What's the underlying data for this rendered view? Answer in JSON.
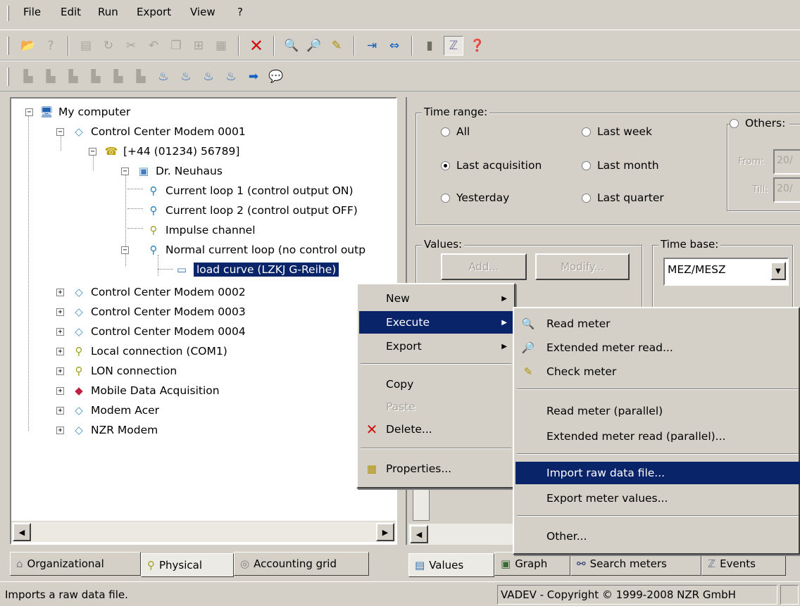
{
  "menubar": {
    "items": [
      "File",
      "Edit",
      "Run",
      "Export",
      "View",
      "?"
    ]
  },
  "tree": {
    "root": "My computer",
    "modem1": "Control Center Modem 0001",
    "phone": "[+44 (01234) 56789]",
    "customer": "Dr. Neuhaus",
    "loop1": "Current loop 1 (control output ON)",
    "loop2": "Current loop 2 (control output OFF)",
    "impulse": "Impulse channel",
    "normal_loop": "Normal current loop (no control outp",
    "load_curve": "load curve (LZKJ G-Reihe)",
    "modem2": "Control Center Modem 0002",
    "modem3": "Control Center Modem 0003",
    "modem4": "Control Center Modem 0004",
    "local": "Local connection (COM1)",
    "lon": "LON connection",
    "mobile": "Mobile Data Acquisition",
    "acer": "Modem Acer",
    "nzr": "NZR Modem"
  },
  "left_tabs": [
    "Organizational",
    "Physical",
    "Accounting grid"
  ],
  "right": {
    "time_range_title": "Time range:",
    "radios": {
      "all": "All",
      "last_acq": "Last acquisition",
      "yesterday": "Yesterday",
      "last_week": "Last week",
      "last_month": "Last month",
      "last_quarter": "Last quarter",
      "others": "Others:"
    },
    "from_label": "From:",
    "till_label": "Till:",
    "from_value": "20/",
    "till_value": "20/",
    "values_title": "Values:",
    "add_label": "Add...",
    "modify_label": "Modify...",
    "timebase_title": "Time base:",
    "timebase_value": "MEZ/MESZ"
  },
  "right_tabs": [
    "Values",
    "Graph",
    "Search meters",
    "Events"
  ],
  "context_menu": {
    "new": "New",
    "execute": "Execute",
    "export": "Export",
    "copy": "Copy",
    "paste": "Paste",
    "delete": "Delete...",
    "properties": "Properties..."
  },
  "submenu": {
    "read_meter": "Read meter",
    "extended_read": "Extended meter read...",
    "check_meter": "Check meter",
    "read_parallel": "Read meter (parallel)",
    "extended_parallel": "Extended meter read (parallel)...",
    "import_raw": "Import raw data file...",
    "export_values": "Export meter values...",
    "other": "Other..."
  },
  "status": {
    "message": "Imports a raw data file.",
    "copyright": "VADEV - Copyright © 1999-2008 NZR GmbH"
  },
  "colors": {
    "highlight": "#0a246a",
    "face": "#d4d0c8"
  }
}
